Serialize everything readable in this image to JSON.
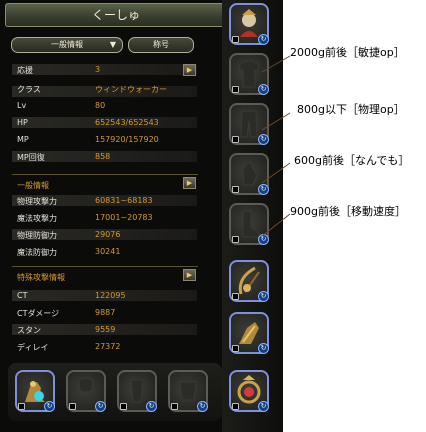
{
  "window": {
    "character_name": "くーしゅ"
  },
  "top": {
    "dropdown_label": "一般情報",
    "title_button_label": "称号"
  },
  "basic_stats": {
    "rows": [
      {
        "label": "応援",
        "value": "3"
      },
      {
        "label": "クラス",
        "value": "ウィンドウォーカー"
      },
      {
        "label": "Lv",
        "value": "80"
      },
      {
        "label": "HP",
        "value": "652543/652543"
      },
      {
        "label": "MP",
        "value": "157920/157920"
      },
      {
        "label": "MP回復",
        "value": "858"
      }
    ]
  },
  "general_info": {
    "header": "一般情報",
    "rows": [
      {
        "label": "物理攻撃力",
        "value": "60831~68183"
      },
      {
        "label": "魔法攻撃力",
        "value": "17001~20783"
      },
      {
        "label": "物理防御力",
        "value": "29076"
      },
      {
        "label": "魔法防御力",
        "value": "30241"
      }
    ]
  },
  "special_attack": {
    "header": "特殊攻撃情報",
    "rows": [
      {
        "label": "CT",
        "value": "122095"
      },
      {
        "label": "CTダメージ",
        "value": "9887"
      },
      {
        "label": "スタン",
        "value": "9559"
      },
      {
        "label": "ディレイ",
        "value": "27372"
      }
    ]
  },
  "annotations": [
    {
      "text": "2000g前後［敏捷op］"
    },
    {
      "text": "800g以下［物理op］"
    },
    {
      "text": "600g前後［なんでも］"
    },
    {
      "text": "900g前後［移動速度］"
    }
  ],
  "icons": {
    "arrow": "▶",
    "dropdown_caret": "▼",
    "refresh": "↻"
  },
  "colors": {
    "value_orange": "#d59a2c",
    "panel_bg": "#0b0b0a",
    "selected_slot": "#8090d8",
    "refresh_blue": "#163f80"
  }
}
